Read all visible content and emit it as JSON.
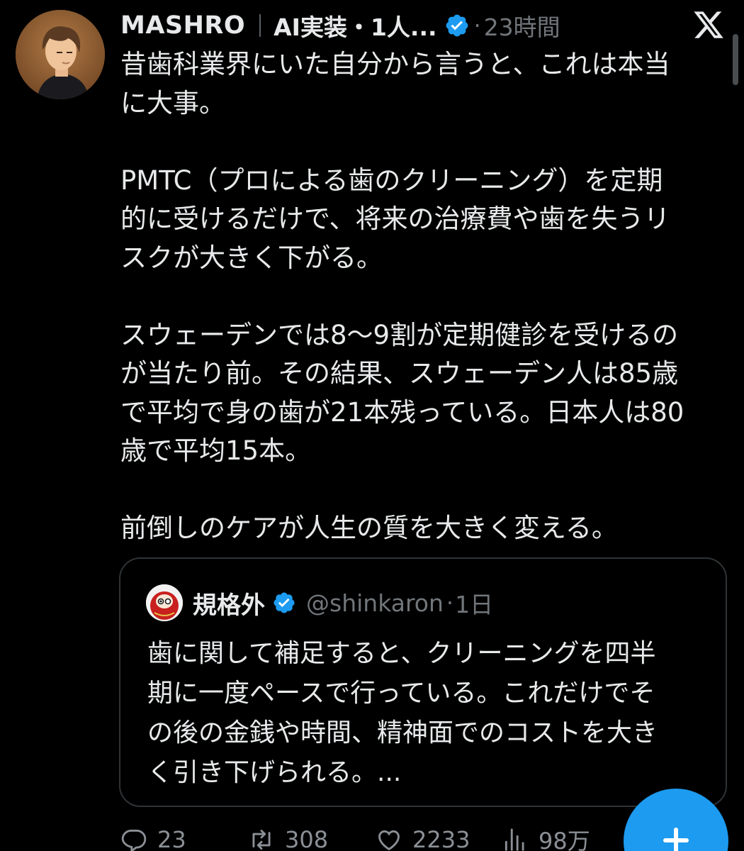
{
  "author": {
    "display_name": "MASHRO",
    "name_suffix": "AI実装・1人...",
    "separator": "·",
    "time": "23時間"
  },
  "tweet": {
    "paragraphs": [
      [
        "昔歯科業界にいた自分から言うと、これは本当",
        "に大事。"
      ],
      [
        "PMTC（プロによる歯のクリーニング）を定期",
        "的に受けるだけで、将来の治療費や歯を失うリ",
        "スクが大きく下がる。"
      ],
      [
        "スウェーデンでは8〜9割が定期健診を受けるの",
        "が当たり前。その結果、スウェーデン人は85歳",
        "で平均で身の歯が21本残っている。日本人は80",
        "歳で平均15本。"
      ],
      [
        "前倒しのケアが人生の質を大きく変える。"
      ]
    ]
  },
  "quote": {
    "name": "規格外",
    "handle": "@shinkaron",
    "separator": "·",
    "time": "1日",
    "lines": [
      "歯に関して補足すると、クリーニングを四半",
      "期に一度ペースで行っている。これだけでそ",
      "の後の金銭や時間、精神面でのコストを大き",
      "く引き下げられる。..."
    ]
  },
  "actions": {
    "replies": "23",
    "reposts": "308",
    "likes": "2233",
    "views": "98万"
  },
  "colors": {
    "background": "#000000",
    "text": "#e7e9ea",
    "secondary": "#71767b",
    "accent": "#1d9bf0",
    "border": "#2f3336"
  },
  "icons": [
    "x-logo-icon",
    "verified-badge-icon",
    "reply-icon",
    "repost-icon",
    "like-icon",
    "views-icon",
    "plus-icon"
  ]
}
